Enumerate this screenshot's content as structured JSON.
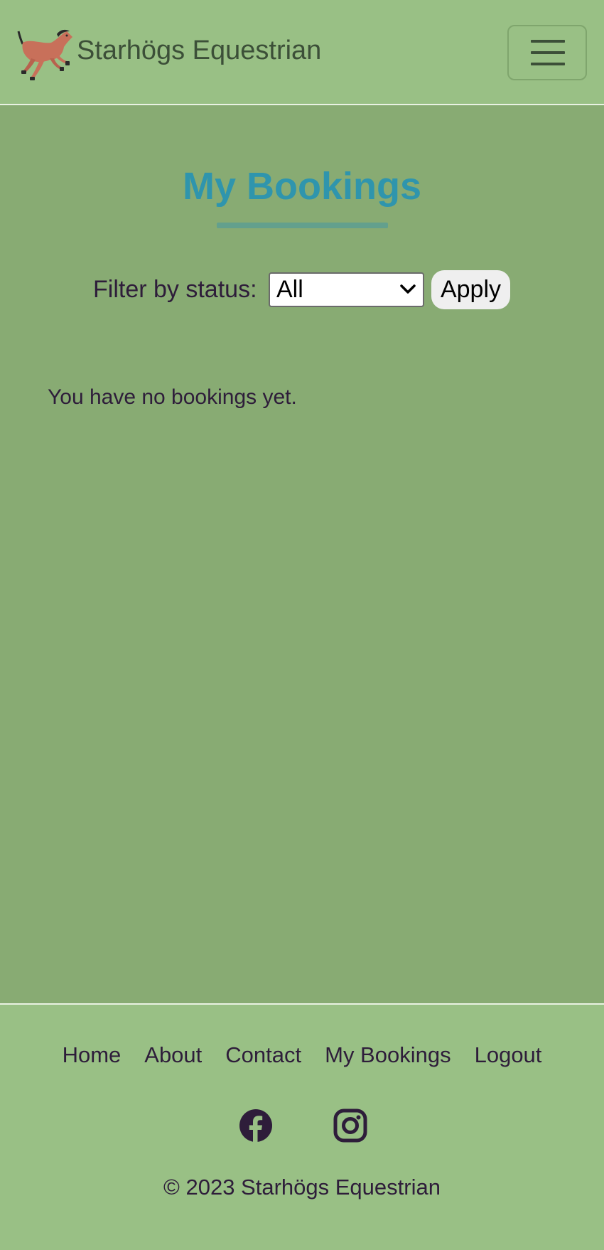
{
  "header": {
    "brand_name": "Starhögs Equestrian",
    "logo_icon": "galloping-horse-icon",
    "menu_icon": "hamburger-menu-icon"
  },
  "main": {
    "title": "My Bookings",
    "filter": {
      "label": "Filter by status:",
      "selected_value": "All",
      "apply_label": "Apply"
    },
    "empty_message": "You have no bookings yet."
  },
  "footer": {
    "nav": [
      {
        "label": "Home"
      },
      {
        "label": "About"
      },
      {
        "label": "Contact"
      },
      {
        "label": "My Bookings"
      },
      {
        "label": "Logout"
      }
    ],
    "social": [
      "facebook-icon",
      "instagram-icon"
    ],
    "copyright": "© 2023 Starhögs Equestrian"
  },
  "colors": {
    "header_bg": "#99c085",
    "main_bg": "#88ab73",
    "title": "#2f95ad",
    "text": "#2e1d3a",
    "brand_text": "#3c4f38"
  }
}
